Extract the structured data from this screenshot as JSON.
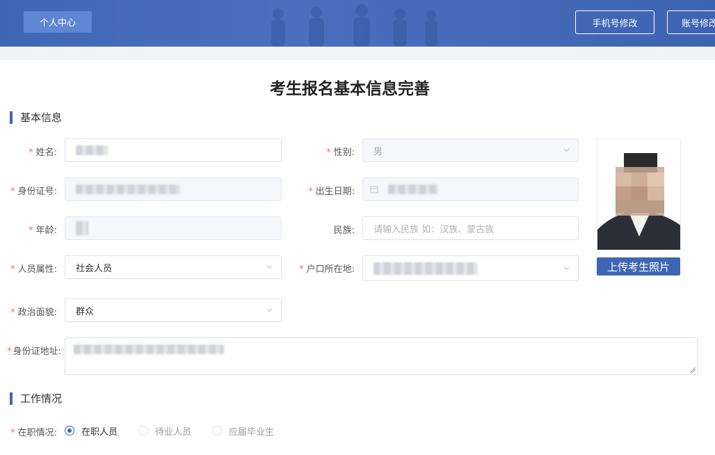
{
  "header": {
    "personal_center": "个人中心",
    "phone_modify": "手机号修改",
    "account_modify": "账号修改"
  },
  "page_title": "考生报名基本信息完善",
  "sections": {
    "basic_info": "基本信息",
    "work_status": "工作情况"
  },
  "required_mark": "*",
  "form": {
    "name": {
      "label": "姓名:"
    },
    "gender": {
      "label": "性别:",
      "value": "男"
    },
    "id_number": {
      "label": "身份证号:"
    },
    "birth_date": {
      "label": "出生日期:"
    },
    "age": {
      "label": "年龄:"
    },
    "ethnicity": {
      "label": "民族:",
      "placeholder": "请输入民族 如：汉族、蒙古族"
    },
    "person_type": {
      "label": "人员属性:",
      "value": "社会人员"
    },
    "household": {
      "label": "户口所在地:"
    },
    "political": {
      "label": "政治面貌:",
      "value": "群众"
    },
    "id_address": {
      "label": "身份证地址:"
    },
    "employment": {
      "label": "在职情况:",
      "options": [
        "在职人员",
        "待业人员",
        "应届毕业生"
      ],
      "selected": "在职人员"
    }
  },
  "upload_photo": "上传考生照片",
  "colors": {
    "primary": "#3f66b5",
    "required": "#f56c6c"
  },
  "icons": [
    "chevron-down-icon",
    "calendar-icon",
    "resize-handle-icon"
  ]
}
